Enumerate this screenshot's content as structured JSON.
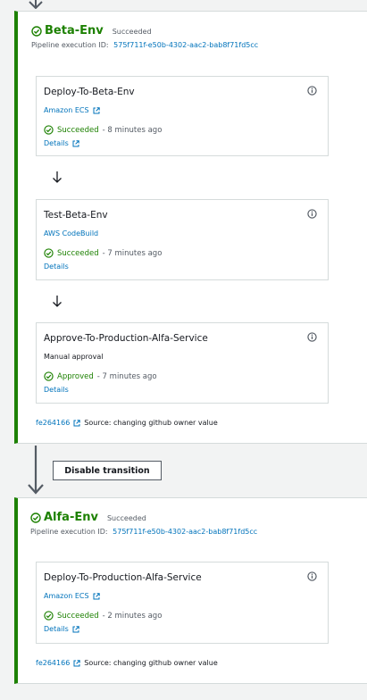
{
  "beta_stage": {
    "name": "Beta-Env",
    "status": "Succeeded",
    "execution_label": "Pipeline execution ID:",
    "execution_id": "575f711f-e50b-4302-aac2-bab8f71fd5cc",
    "actions": [
      {
        "name": "Deploy-To-Beta-Env",
        "provider": "Amazon ECS",
        "status": "Succeeded",
        "time": "- 8 minutes ago",
        "details": "Details"
      },
      {
        "name": "Test-Beta-Env",
        "provider": "AWS CodeBuild",
        "status": "Succeeded",
        "time": "- 7 minutes ago",
        "details": "Details"
      },
      {
        "name": "Approve-To-Production-Alfa-Service",
        "provider": "Manual approval",
        "status": "Approved",
        "time": "- 7 minutes ago",
        "details": "Details"
      }
    ],
    "source_commit": "fe264166",
    "source_message": "Source: changing github owner value"
  },
  "transition": {
    "button_label": "Disable transition"
  },
  "alfa_stage": {
    "name": "Alfa-Env",
    "status": "Succeeded",
    "execution_label": "Pipeline execution ID:",
    "execution_id": "575f711f-e50b-4302-aac2-bab8f71fd5cc",
    "actions": [
      {
        "name": "Deploy-To-Production-Alfa-Service",
        "provider": "Amazon ECS",
        "status": "Succeeded",
        "time": "- 2 minutes ago",
        "details": "Details"
      }
    ],
    "source_commit": "fe264166",
    "source_message": "Source: changing github owner value"
  },
  "colors": {
    "success": "#1d8102",
    "link": "#0073bb",
    "muted": "#545b64",
    "arrow": "#545b64"
  },
  "icons": {
    "stage_status": "check-circle-icon",
    "action_status": "check-circle-icon",
    "info": "info-icon",
    "external": "external-link-icon",
    "flow": "down-arrow-icon"
  }
}
